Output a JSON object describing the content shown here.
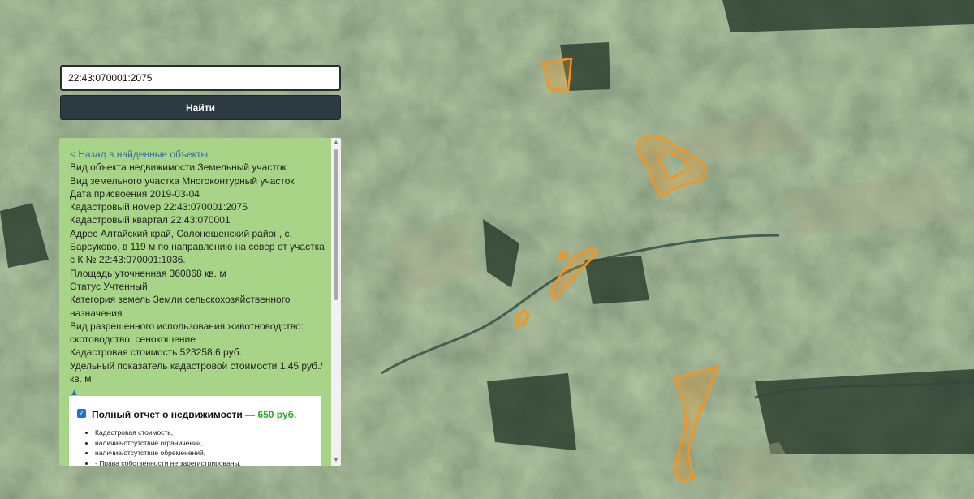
{
  "search": {
    "value": "22:43:070001:2075",
    "button_label": "Найти"
  },
  "panel": {
    "back_link": "< Назад в найденные объекты",
    "rows": [
      "Вид объекта недвижимости Земельный участок",
      "Вид земельного участка Многоконтурный участок",
      "Дата присвоения 2019-03-04",
      "Кадастровый номер 22:43:070001:2075",
      "Кадастровый квартал 22:43:070001",
      "Адрес Алтайский край, Солонешенский район, с. Барсуково, в 119 м по направлению на север от участка с К № 22:43:070001:1036.",
      "Площадь уточненная 360868 кв. м",
      "Статус Учтенный",
      "Категория земель Земли сельскохозяйственного назначения",
      "Вид разрешенного использования животноводство: скотоводство: сенокошение",
      "Кадастровая стоимость 523258.6 руб.",
      "Удельный показатель кадастровой стоимости 1.45 руб./кв. м"
    ],
    "collapse_arrow": "▲",
    "report": {
      "title": "Полный отчет о недвижимости —",
      "price": "650 руб.",
      "items": [
        "Кадастровая стоимость,",
        "наличие/отсутствие ограничений,",
        "наличие/отсутствие обременений,",
        "- Права собственности не зарегистрированы,"
      ]
    }
  },
  "map": {
    "parcel_color": "#f7941d"
  }
}
